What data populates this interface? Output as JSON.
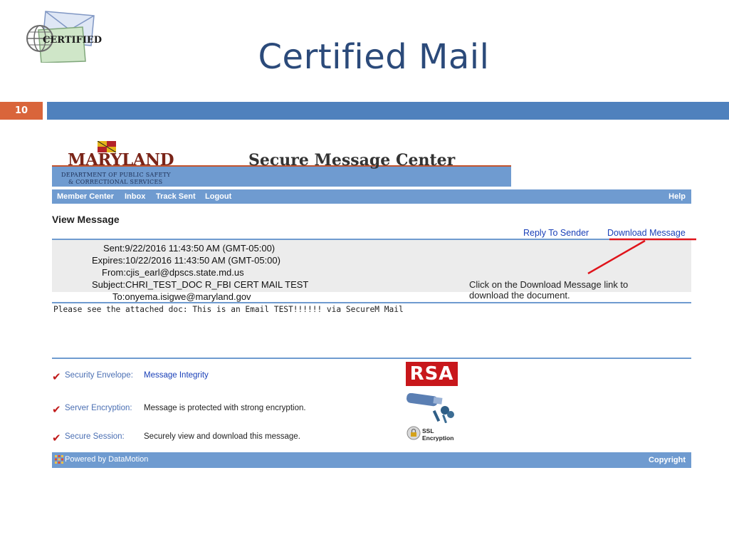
{
  "slide": {
    "title": "Certified Mail",
    "number": "10",
    "logo_text": "CERTIFIED"
  },
  "banner": {
    "org_name": "MARYLAND",
    "org_sub1": "DEPARTMENT OF PUBLIC SAFETY",
    "org_sub2": "& CORRECTIONAL SERVICES",
    "app_title": "Secure Message Center"
  },
  "nav": {
    "items": [
      "Member Center",
      "Inbox",
      "Track Sent",
      "Logout"
    ],
    "help": "Help"
  },
  "message": {
    "view_title": "View Message",
    "reply_link": "Reply To Sender",
    "download_link": "Download Message",
    "headers": {
      "sent": "Sent:9/22/2016 11:43:50 AM (GMT-05:00)",
      "expires": "Expires:10/22/2016 11:43:50 AM (GMT-05:00)",
      "from": "From:cjis_earl@dpscs.state.md.us",
      "subject": "Subject:CHRI_TEST_DOC R_FBI CERT MAIL TEST",
      "to": "To:onyema.isigwe@maryland.gov"
    },
    "body": "Please see the attached doc: This is an Email TEST!!!!!! via SecureM Mail"
  },
  "annotation": {
    "line1": "Click on the Download Message link to",
    "line2": "download the document."
  },
  "security": [
    {
      "label": "Security Envelope:",
      "value": "Message Integrity"
    },
    {
      "label": "Server Encryption:",
      "value": "Message is protected with strong encryption."
    },
    {
      "label": "Secure Session:",
      "value": "Securely view and download this message."
    }
  ],
  "badges": {
    "rsa": "RSA",
    "ssl_line1": "SSL",
    "ssl_line2": "Encryption"
  },
  "footer": {
    "powered": "Powered by DataMotion",
    "copyright": "Copyright"
  },
  "colors": {
    "slide_title": "#2b4a7a",
    "slide_bar": "#4f81bd",
    "slide_number_bg": "#d9653b",
    "nav_bar": "#6f9bd0",
    "link": "#1a40b8",
    "check": "#c11b1b",
    "annotation_arrow": "#e0141b"
  }
}
